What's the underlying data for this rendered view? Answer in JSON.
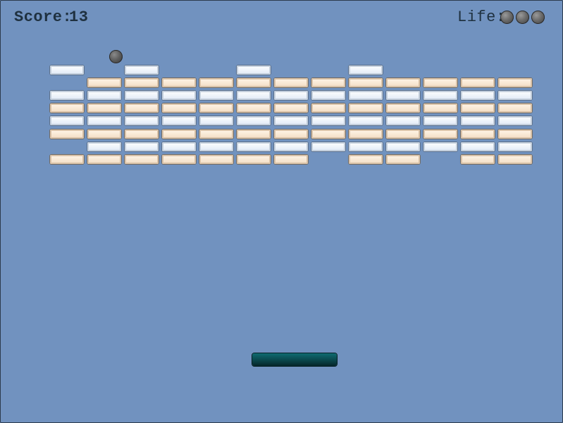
{
  "hud": {
    "score_label": "Score:",
    "score_value": "13",
    "life_label": "Life:",
    "lives_remaining": 3
  },
  "colors": {
    "background": "#7192bf",
    "brick_white": "#eef4fb",
    "brick_cream": "#f8e6d2",
    "paddle": "#0b4d52",
    "ball": "#5e5e5e"
  },
  "bricks": {
    "columns": 13,
    "rows": [
      [
        "w",
        "",
        "w",
        "",
        "",
        "w",
        "",
        "",
        "w",
        "",
        "",
        "",
        ""
      ],
      [
        "",
        "c",
        "c",
        "c",
        "c",
        "c",
        "c",
        "c",
        "c",
        "c",
        "c",
        "c",
        "c"
      ],
      [
        "w",
        "w",
        "w",
        "w",
        "w",
        "w",
        "w",
        "w",
        "w",
        "w",
        "w",
        "w",
        "w"
      ],
      [
        "c",
        "c",
        "c",
        "c",
        "c",
        "c",
        "c",
        "c",
        "c",
        "c",
        "c",
        "c",
        "c"
      ],
      [
        "w",
        "w",
        "w",
        "w",
        "w",
        "w",
        "w",
        "w",
        "w",
        "w",
        "w",
        "w",
        "w"
      ],
      [
        "c",
        "c",
        "c",
        "c",
        "c",
        "c",
        "c",
        "c",
        "c",
        "c",
        "c",
        "c",
        "c"
      ],
      [
        "",
        "w",
        "w",
        "w",
        "w",
        "w",
        "w",
        "w",
        "w",
        "w",
        "w",
        "w",
        "w"
      ],
      [
        "c",
        "c",
        "c",
        "c",
        "c",
        "c",
        "c",
        "",
        "c",
        "c",
        "",
        "c",
        "c"
      ]
    ]
  }
}
